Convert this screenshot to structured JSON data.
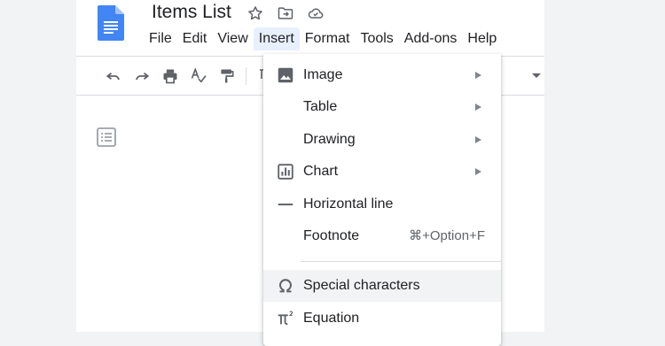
{
  "document": {
    "title": "Items List"
  },
  "menubar": {
    "items": [
      {
        "label": "File"
      },
      {
        "label": "Edit"
      },
      {
        "label": "View"
      },
      {
        "label": "Insert"
      },
      {
        "label": "Format"
      },
      {
        "label": "Tools"
      },
      {
        "label": "Add-ons"
      },
      {
        "label": "Help"
      }
    ],
    "active": "Insert"
  },
  "toolbar": {
    "icons": [
      "undo-icon",
      "redo-icon",
      "print-icon",
      "spellcheck-icon",
      "paint-format-icon"
    ]
  },
  "insert_menu": {
    "items": [
      {
        "label": "Image",
        "icon": "image-icon",
        "submenu": true
      },
      {
        "label": "Table",
        "icon": "",
        "submenu": true
      },
      {
        "label": "Drawing",
        "icon": "",
        "submenu": true
      },
      {
        "label": "Chart",
        "icon": "chart-icon",
        "submenu": true
      },
      {
        "label": "Horizontal line",
        "icon": "horizontal-line-icon",
        "submenu": false
      },
      {
        "label": "Footnote",
        "icon": "",
        "shortcut": "⌘+Option+F",
        "submenu": false
      },
      {
        "label": "Special characters",
        "icon": "omega-icon",
        "submenu": false,
        "highlighted": true
      },
      {
        "label": "Equation",
        "icon": "pi-icon",
        "submenu": false
      }
    ]
  },
  "colors": {
    "docs_blue": "#4285f4",
    "menu_active_bg": "#e8f0fe",
    "menu_hover_bg": "#f1f3f4",
    "page_bg": "#f1f3f4",
    "icon_gray": "#5f6368"
  }
}
